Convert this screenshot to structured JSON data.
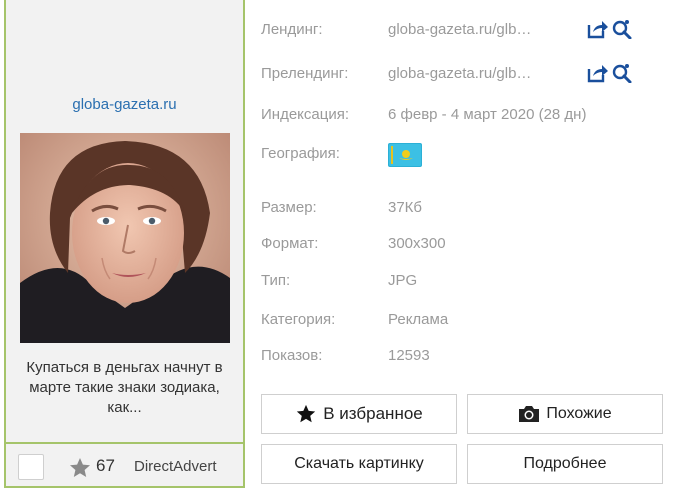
{
  "ad_card": {
    "domain": "globa-gazeta.ru",
    "headline": "Купаться в деньгах начнут в марте такие знаки зодиака, как...",
    "star_count": "67",
    "network": "DirectAdvert"
  },
  "details": [
    {
      "label": "Лендинг:",
      "value": "globa-gazeta.ru/glb…",
      "has_tools": true
    },
    {
      "label": "Прелендинг:",
      "value": "globa-gazeta.ru/glb…",
      "has_tools": true
    },
    {
      "label": "Индексация:",
      "value": "6 февр - 4 март 2020 (28 дн)"
    },
    {
      "label": "География:",
      "value": ""
    },
    {
      "label": "Размер:",
      "value": "37Кб"
    },
    {
      "label": "Формат:",
      "value": "300x300"
    },
    {
      "label": "Тип:",
      "value": "JPG"
    },
    {
      "label": "Категория:",
      "value": "Реклама"
    },
    {
      "label": "Показов:",
      "value": "12593"
    }
  ],
  "geography_flag": "kazakhstan-flag-icon",
  "buttons": {
    "favorite": "В избранное",
    "similar": "Похожие",
    "download": "Скачать картинку",
    "more": "Подробнее"
  },
  "colors": {
    "link": "#2a6fb0",
    "card_border": "#a5c46a",
    "muted_text": "#9a9a9a",
    "tool_icon": "#1a4f9c"
  }
}
